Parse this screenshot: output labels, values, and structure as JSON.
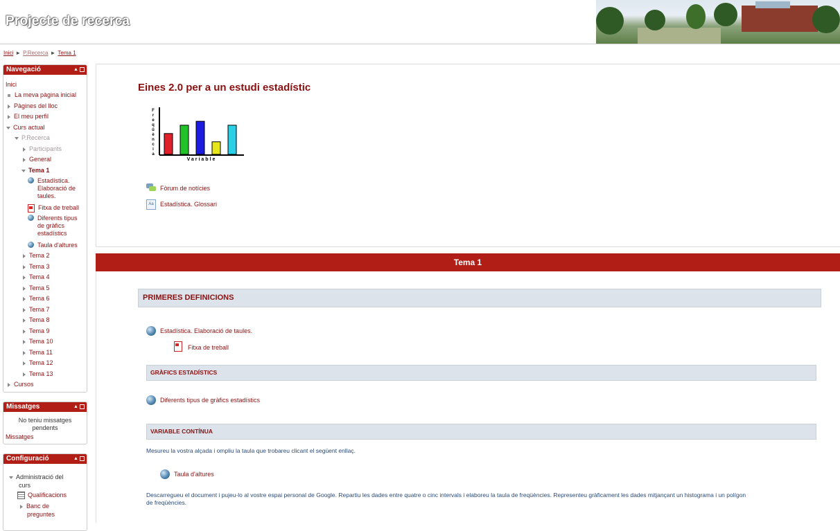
{
  "header": {
    "site_title": "Projecte de recerca"
  },
  "breadcrumb": {
    "home": "Inici",
    "course": "P.Recerca",
    "current": "Tema 1",
    "sep": "►"
  },
  "navigation": {
    "title": "Navegació",
    "items": {
      "inici": "Inici",
      "my_home": "La meva pàgina inicial",
      "site_pages": "Pàgines del lloc",
      "profile": "El meu perfil",
      "current_course": "Curs actual",
      "course": "P.Recerca",
      "participants": "Participants",
      "general": "General",
      "tema1": "Tema 1",
      "tema1_children": {
        "a1": "Estadística.",
        "a2": "Elaboració de",
        "a3": "taules.",
        "b1": "Fitxa de treball",
        "c1": "Diferents tipus",
        "c2": "de gràfics",
        "c3": "estadístics",
        "d1": "Taula d'altures"
      },
      "temas": [
        "Tema 2",
        "Tema 3",
        "Tema 4",
        "Tema 5",
        "Tema 6",
        "Tema 7",
        "Tema 8",
        "Tema 9",
        "Tema 10",
        "Tema 11",
        "Tema 12",
        "Tema 13"
      ],
      "cursos": "Cursos"
    }
  },
  "messages": {
    "title": "Missatges",
    "empty_1": "No teniu missatges",
    "empty_2": "pendents",
    "link": "Missatges"
  },
  "config": {
    "title": "Configuració",
    "admin_1": "Administració del",
    "admin_2": "curs",
    "grades": "Qualificacions",
    "bank_1": "Banc de",
    "bank_2": "preguntes"
  },
  "main": {
    "course_title": "Eines 2.0 per a un estudi estadístic",
    "activities": {
      "forum": "Fòrum de notícies",
      "glossary": "Estadística. Glossari"
    },
    "chart_image": {
      "ylabel_letters": [
        "F",
        "r",
        "e",
        "q",
        "ü",
        "è",
        "n",
        "c",
        "i",
        "a"
      ],
      "xlabel": "Variable",
      "bars": [
        {
          "color": "#e0202a",
          "value": 0.58
        },
        {
          "color": "#22c32a",
          "value": 0.81
        },
        {
          "color": "#1c1ce0",
          "value": 0.92
        },
        {
          "color": "#e6e61a",
          "value": 0.35
        },
        {
          "color": "#2ad0e6",
          "value": 0.81
        }
      ]
    }
  },
  "section": {
    "title": "Tema 1",
    "label_1": "PRIMERES DEFINICIONS",
    "act_1": "Estadística. Elaboració de taules.",
    "act_2": "Fitxa de treball",
    "label_2": "GRÀFICS ESTADÍSTICS",
    "act_3": "Diferents tipus de gràfics estadístics",
    "label_3": "VARIABLE CONTÍNUA",
    "text_1": "Mesureu la vostra alçada i ompliu la taula que trobareu clicant el següent enllaç.",
    "act_4": "Taula d'altures",
    "text_2a": "Descarregueu el document i pujeu-lo al vostre espai personal de Google. Repartiu les dades entre quatre o cinc intervals i elaboreu la taula de freqüències. Representeu gràficament les dades mitjançant un histograma i un polígon",
    "text_2b": "de freqüències."
  },
  "colors": {
    "accent": "#b11e16",
    "link": "#8b1010",
    "label_bg": "#dde3ea"
  }
}
